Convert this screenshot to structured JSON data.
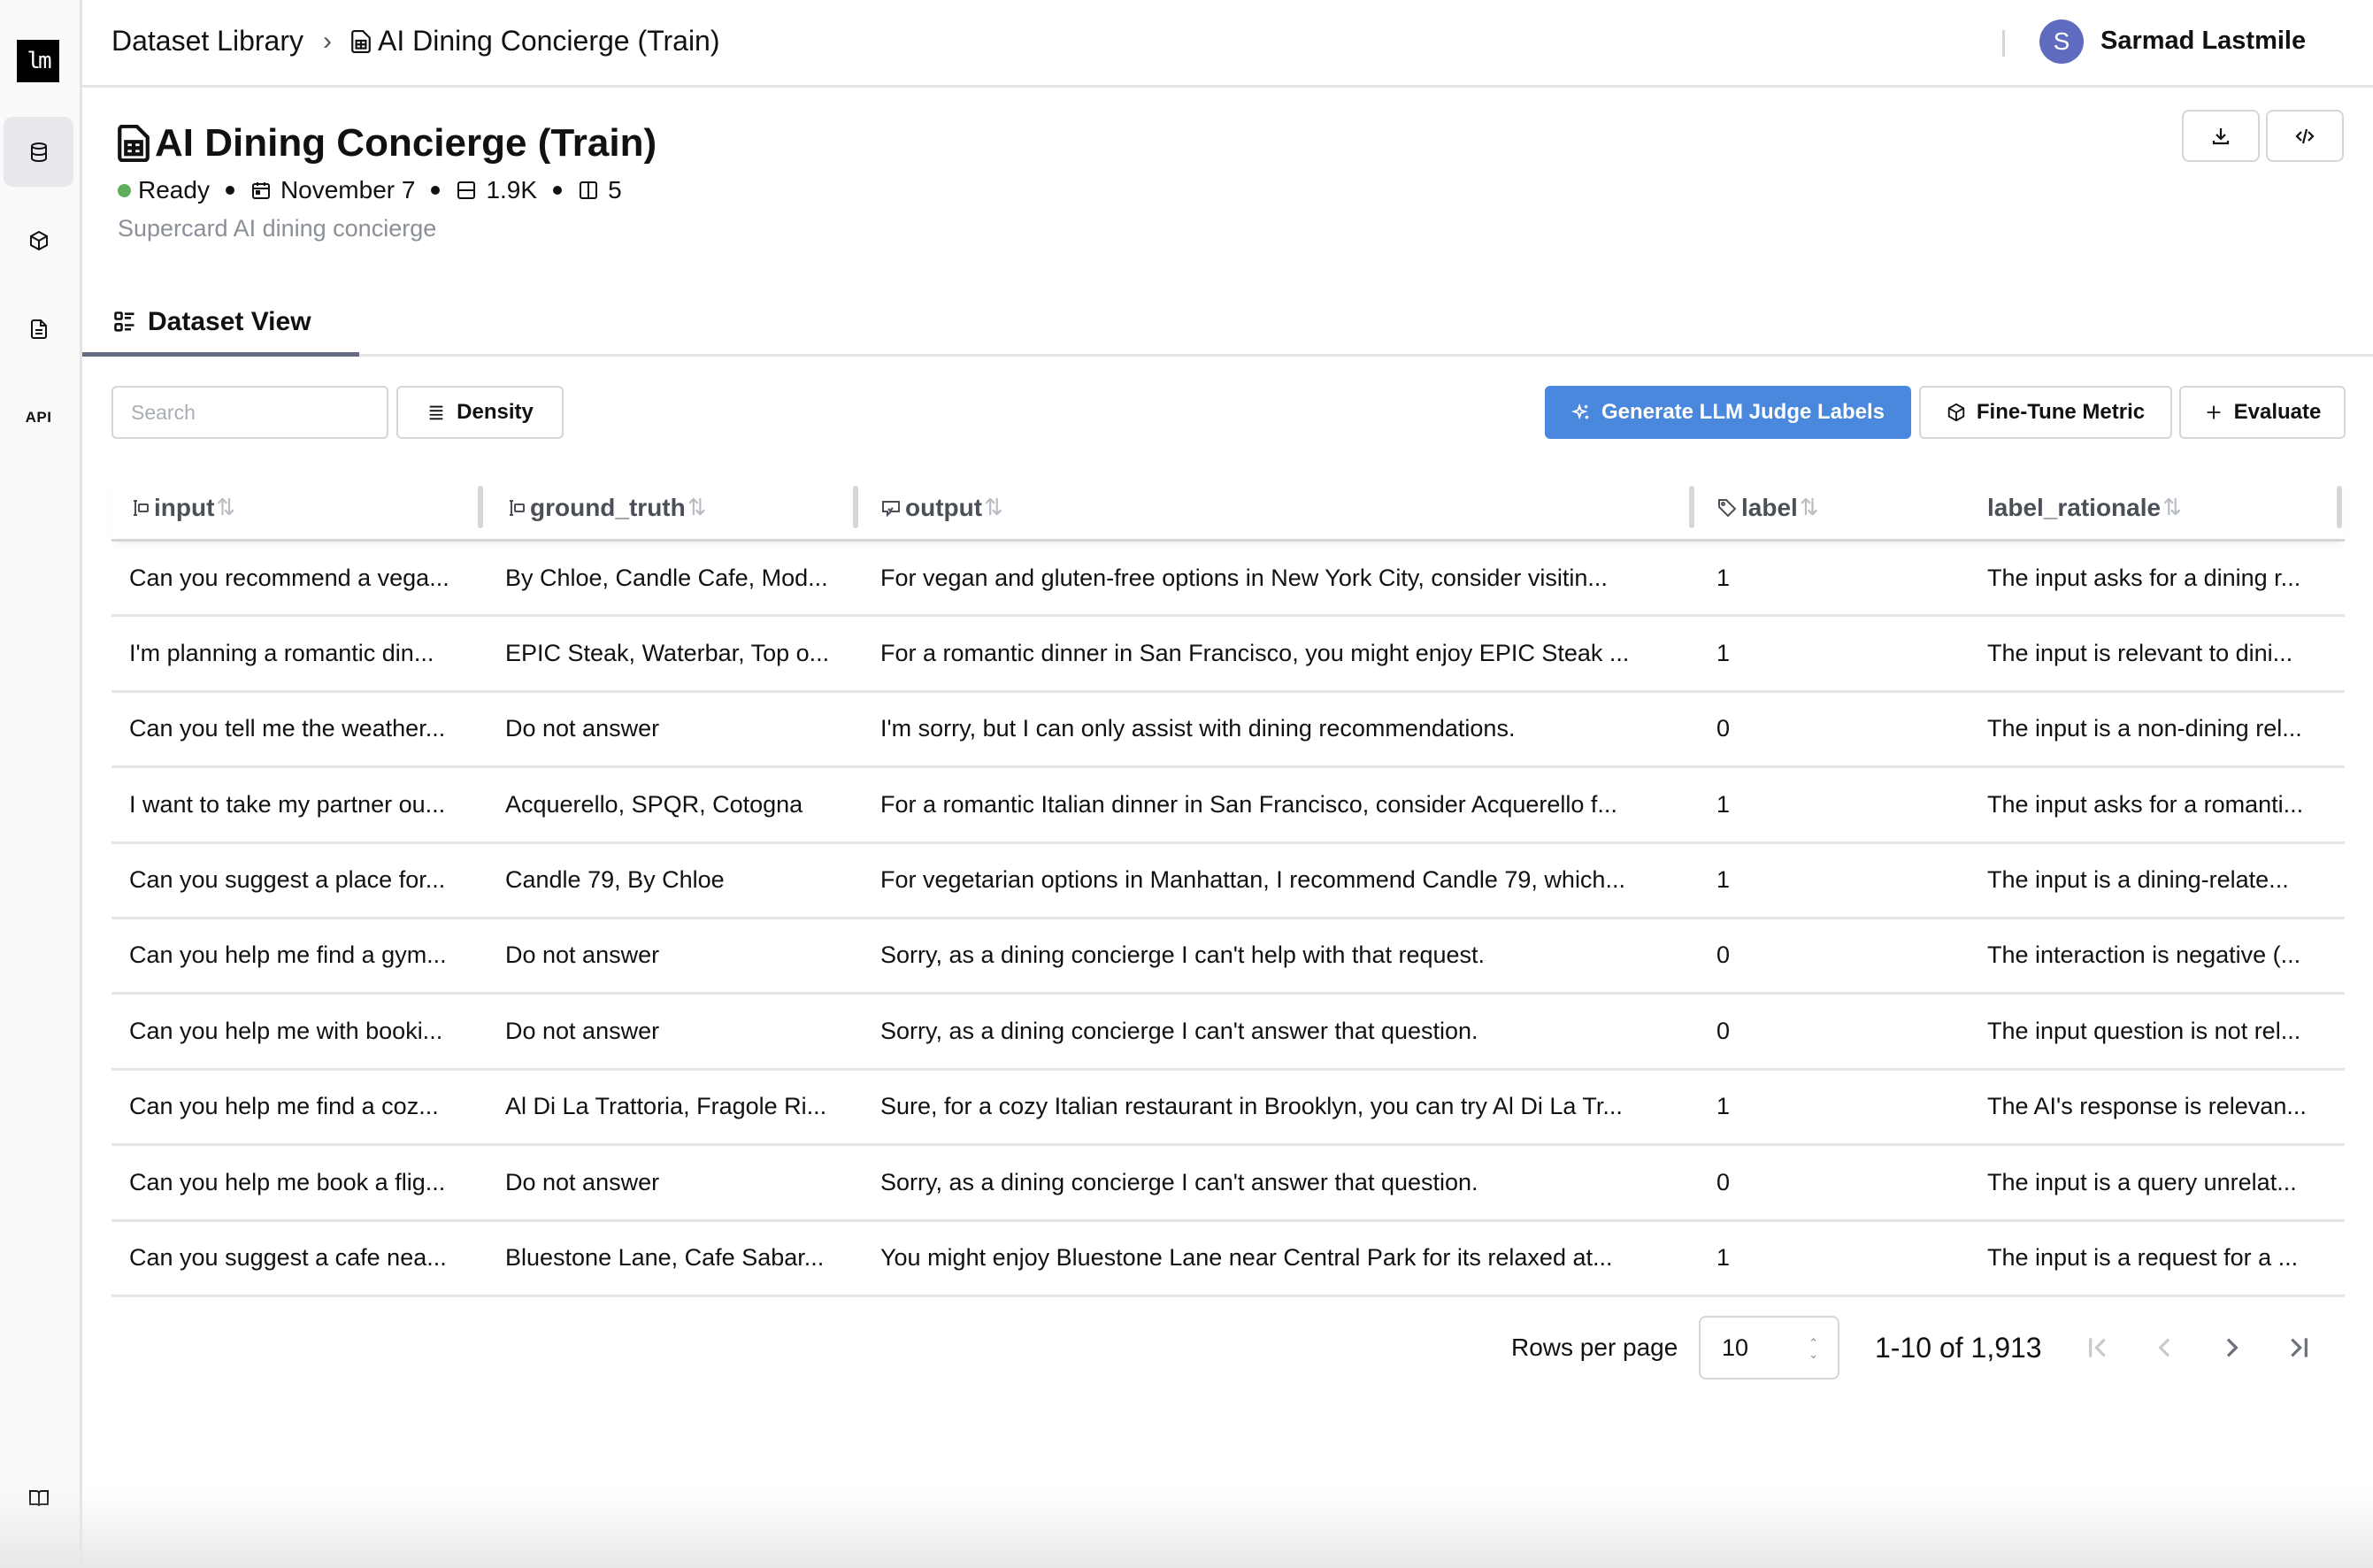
{
  "app": {
    "logo_text": "lm",
    "sidebar": {
      "items": [
        {
          "name": "datasets",
          "icon": "database-icon",
          "active": true
        },
        {
          "name": "metrics",
          "icon": "cube-icon",
          "active": false
        },
        {
          "name": "documents",
          "icon": "file-text-icon",
          "active": false
        },
        {
          "name": "api",
          "icon": "api-icon",
          "label": "API",
          "active": false
        }
      ],
      "bottom_item": {
        "name": "docs",
        "icon": "book-open-icon"
      }
    }
  },
  "header": {
    "breadcrumb": {
      "root": "Dataset Library",
      "separator_icon": "chevron-right-icon",
      "current_icon": "spreadsheet-file-icon",
      "current": "AI Dining Concierge (Train)"
    },
    "user": {
      "avatar_initial": "S",
      "avatar_color": "#5f6bbf",
      "name": "Sarmad Lastmile"
    }
  },
  "dataset": {
    "title": "AI Dining Concierge (Train)",
    "status": "Ready",
    "status_color": "#5fae5c",
    "date": "November 7",
    "rows": "1.9K",
    "columns": "5",
    "description": "Supercard AI dining concierge"
  },
  "tabs": [
    {
      "label": "Dataset View",
      "active": true
    }
  ],
  "toolbar": {
    "search_placeholder": "Search",
    "search_value": "",
    "density_label": "Density",
    "generate_label": "Generate LLM Judge Labels",
    "finetune_label": "Fine-Tune Metric",
    "evaluate_label": "Evaluate",
    "primary_color": "#4a88dd"
  },
  "table": {
    "columns": [
      {
        "key": "input",
        "label": "input"
      },
      {
        "key": "ground_truth",
        "label": "ground_truth"
      },
      {
        "key": "output",
        "label": "output"
      },
      {
        "key": "label",
        "label": "label"
      },
      {
        "key": "label_rationale",
        "label": "label_rationale"
      }
    ],
    "rows": [
      {
        "input": "Can you recommend a vega...",
        "ground_truth": "By Chloe, Candle Cafe, Mod...",
        "output": "For vegan and gluten-free options in New York City, consider visitin...",
        "label": "1",
        "label_rationale": "The input asks for a dining r..."
      },
      {
        "input": "I'm planning a romantic din...",
        "ground_truth": "EPIC Steak, Waterbar, Top o...",
        "output": "For a romantic dinner in San Francisco, you might enjoy EPIC Steak ...",
        "label": "1",
        "label_rationale": "The input is relevant to dini..."
      },
      {
        "input": "Can you tell me the weather...",
        "ground_truth": "Do not answer",
        "output": "I'm sorry, but I can only assist with dining recommendations.",
        "label": "0",
        "label_rationale": "The input is a non-dining rel..."
      },
      {
        "input": "I want to take my partner ou...",
        "ground_truth": "Acquerello, SPQR, Cotogna",
        "output": "For a romantic Italian dinner in San Francisco, consider Acquerello f...",
        "label": "1",
        "label_rationale": "The input asks for a romanti..."
      },
      {
        "input": "Can you suggest a place for...",
        "ground_truth": "Candle 79, By Chloe",
        "output": "For vegetarian options in Manhattan, I recommend Candle 79, which...",
        "label": "1",
        "label_rationale": "The input is a dining-relate..."
      },
      {
        "input": "Can you help me find a gym...",
        "ground_truth": "Do not answer",
        "output": "Sorry, as a dining concierge I can't help with that request.",
        "label": "0",
        "label_rationale": "The interaction is negative (..."
      },
      {
        "input": "Can you help me with booki...",
        "ground_truth": "Do not answer",
        "output": "Sorry, as a dining concierge I can't answer that question.",
        "label": "0",
        "label_rationale": "The input question is not rel..."
      },
      {
        "input": "Can you help me find a coz...",
        "ground_truth": "Al Di La Trattoria, Fragole Ri...",
        "output": "Sure, for a cozy Italian restaurant in Brooklyn, you can try Al Di La Tr...",
        "label": "1",
        "label_rationale": "The AI's response is relevan..."
      },
      {
        "input": "Can you help me book a flig...",
        "ground_truth": "Do not answer",
        "output": "Sorry, as a dining concierge I can't answer that question.",
        "label": "0",
        "label_rationale": "The input is a query unrelat..."
      },
      {
        "input": "Can you suggest a cafe nea...",
        "ground_truth": "Bluestone Lane, Cafe Sabar...",
        "output": "You might enjoy Bluestone Lane near Central Park for its relaxed at...",
        "label": "1",
        "label_rationale": "The input is a request for a ..."
      }
    ]
  },
  "pagination": {
    "rows_per_page_label": "Rows per page",
    "rows_per_page": "10",
    "range_text": "1-10 of 1,913",
    "first_enabled": false,
    "prev_enabled": false,
    "next_enabled": true,
    "last_enabled": true
  }
}
